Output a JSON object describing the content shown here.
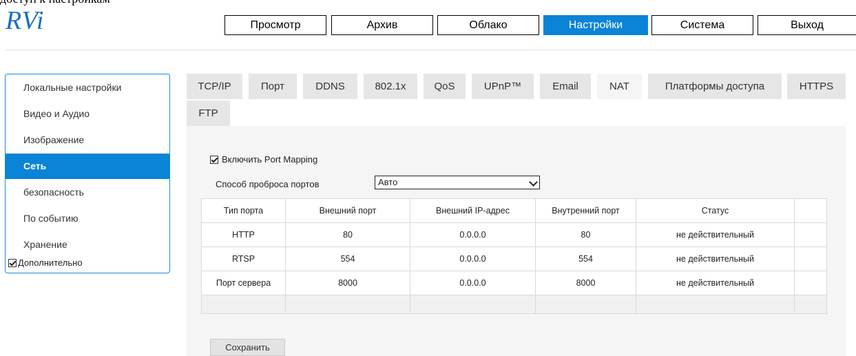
{
  "header": {
    "top_text": "доступ к настройкам",
    "logo": "RVi",
    "nav": [
      {
        "label": "Просмотр"
      },
      {
        "label": "Архив"
      },
      {
        "label": "Облако"
      },
      {
        "label": "Настройки"
      },
      {
        "label": "Система"
      },
      {
        "label": "Выход"
      }
    ],
    "active_nav": "Настройки"
  },
  "sidebar": {
    "items": [
      {
        "label": "Локальные настройки"
      },
      {
        "label": "Видео и Аудио"
      },
      {
        "label": "Изображение"
      },
      {
        "label": "Сеть"
      },
      {
        "label": "безопасность"
      },
      {
        "label": "По событию"
      },
      {
        "label": "Хранение"
      }
    ],
    "active": "Сеть",
    "advanced_label": "Дополнительно",
    "advanced_checked": true
  },
  "tabs": [
    {
      "label": "TCP/IP"
    },
    {
      "label": "Порт"
    },
    {
      "label": "DDNS"
    },
    {
      "label": "802.1x"
    },
    {
      "label": "QoS"
    },
    {
      "label": "UPnP™"
    },
    {
      "label": "Email"
    },
    {
      "label": "NAT"
    },
    {
      "label": "Платформы доступа"
    },
    {
      "label": "HTTPS"
    },
    {
      "label": "FTP"
    }
  ],
  "active_tab": "NAT",
  "nat": {
    "enable_label": "Включить Port Mapping",
    "enable_checked": true,
    "mode_label": "Способ проброса портов",
    "mode_value": "Авто",
    "columns": [
      "Тип порта",
      "Внешний порт",
      "Внешний IP-адрес",
      "Внутренний порт",
      "Статус",
      ""
    ],
    "rows": [
      [
        "HTTP",
        "80",
        "0.0.0.0",
        "80",
        "не действительный",
        ""
      ],
      [
        "RTSP",
        "554",
        "0.0.0.0",
        "554",
        "не действительный",
        ""
      ],
      [
        "Порт сервера",
        "8000",
        "0.0.0.0",
        "8000",
        "не действительный",
        ""
      ],
      [
        "",
        "",
        "",
        "",
        "",
        ""
      ]
    ],
    "save_label": "Сохранить"
  },
  "colors": {
    "accent": "#0a84d6",
    "panel_bg": "#f5f5f5",
    "tab_bg": "#e6e6e6"
  }
}
